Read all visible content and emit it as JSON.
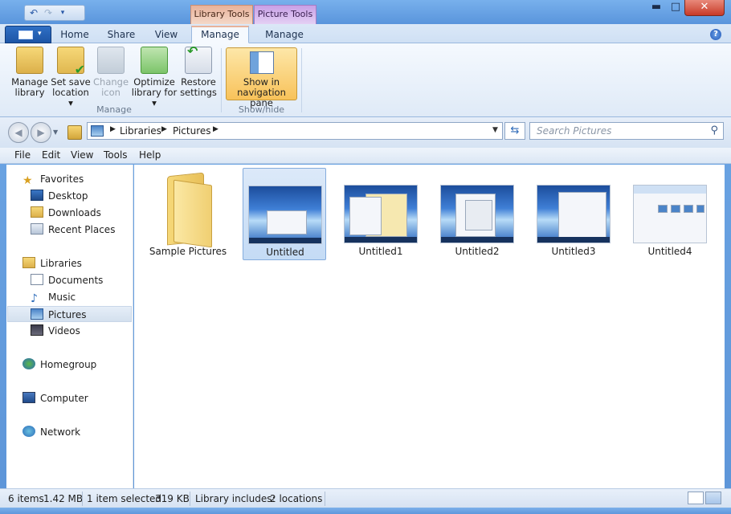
{
  "titlebar": {
    "context_library": "Library Tools",
    "context_picture": "Picture Tools",
    "minimize": "▬",
    "maximize": "□",
    "close": "✕"
  },
  "tabs": {
    "home": "Home",
    "share": "Share",
    "view": "View",
    "manage_library": "Manage",
    "manage_picture": "Manage",
    "help": "?"
  },
  "ribbon": {
    "manage_library": "Manage library",
    "set_save_location": "Set save location ▾",
    "change_icon": "Change icon",
    "optimize_library": "Optimize library for ▾",
    "restore_settings": "Restore settings",
    "group_manage": "Manage",
    "show_nav_pane": "Show in navigation pane",
    "group_showhide": "Show/hide"
  },
  "address": {
    "crumb1": "Libraries",
    "crumb2": "Pictures",
    "search_placeholder": "Search Pictures"
  },
  "menu": {
    "file": "File",
    "edit": "Edit",
    "view": "View",
    "tools": "Tools",
    "help": "Help"
  },
  "nav": {
    "favorites": "Favorites",
    "desktop": "Desktop",
    "downloads": "Downloads",
    "recent_places": "Recent Places",
    "libraries": "Libraries",
    "documents": "Documents",
    "music": "Music",
    "pictures": "Pictures",
    "videos": "Videos",
    "homegroup": "Homegroup",
    "computer": "Computer",
    "network": "Network"
  },
  "files": [
    {
      "name": "Sample Pictures",
      "type": "folder"
    },
    {
      "name": "Untitled",
      "type": "image",
      "selected": true
    },
    {
      "name": "Untitled1",
      "type": "image"
    },
    {
      "name": "Untitled2",
      "type": "image"
    },
    {
      "name": "Untitled3",
      "type": "image"
    },
    {
      "name": "Untitled4",
      "type": "image"
    }
  ],
  "status": {
    "items": "6 items",
    "size": "1.42 MB",
    "selected": "1 item selected",
    "selected_size": "319 KB",
    "library_includes_label": "Library includes:",
    "locations": "2 locations"
  },
  "colors": {
    "accent": "#5a95dc",
    "selection": "#c4dbf5",
    "ctx_library": "#e8b29a",
    "ctx_picture": "#c8a0e6"
  }
}
